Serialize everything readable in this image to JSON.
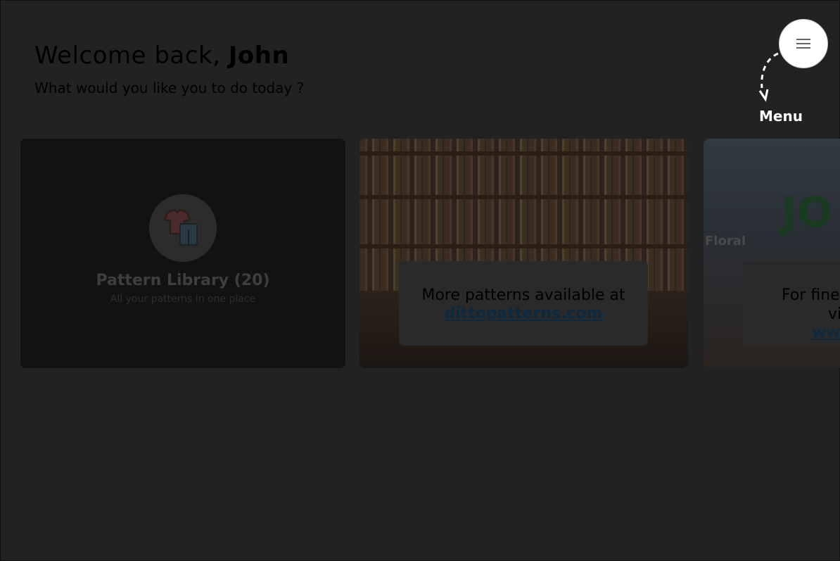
{
  "header": {
    "welcome_prefix": "Welcome back,",
    "user_name": "John",
    "subtitle": "What would you like you to do today ?"
  },
  "menu": {
    "label": "Menu",
    "icon": "hamburger-icon"
  },
  "cards": {
    "library": {
      "title": "Pattern Library (20)",
      "subtitle": "All your patterns in one place",
      "icon": "clothes-icon"
    },
    "store": {
      "text": "More patterns available at",
      "link": "dittopatterns.com"
    },
    "exterior": {
      "sign": "Floral",
      "logo": "JO",
      "text_line1": "For fine",
      "text_line2": "vi",
      "link": "www"
    }
  },
  "colors": {
    "backdrop": "#222222",
    "accent_link": "#0d2940",
    "menu_button": "#ffffff"
  }
}
